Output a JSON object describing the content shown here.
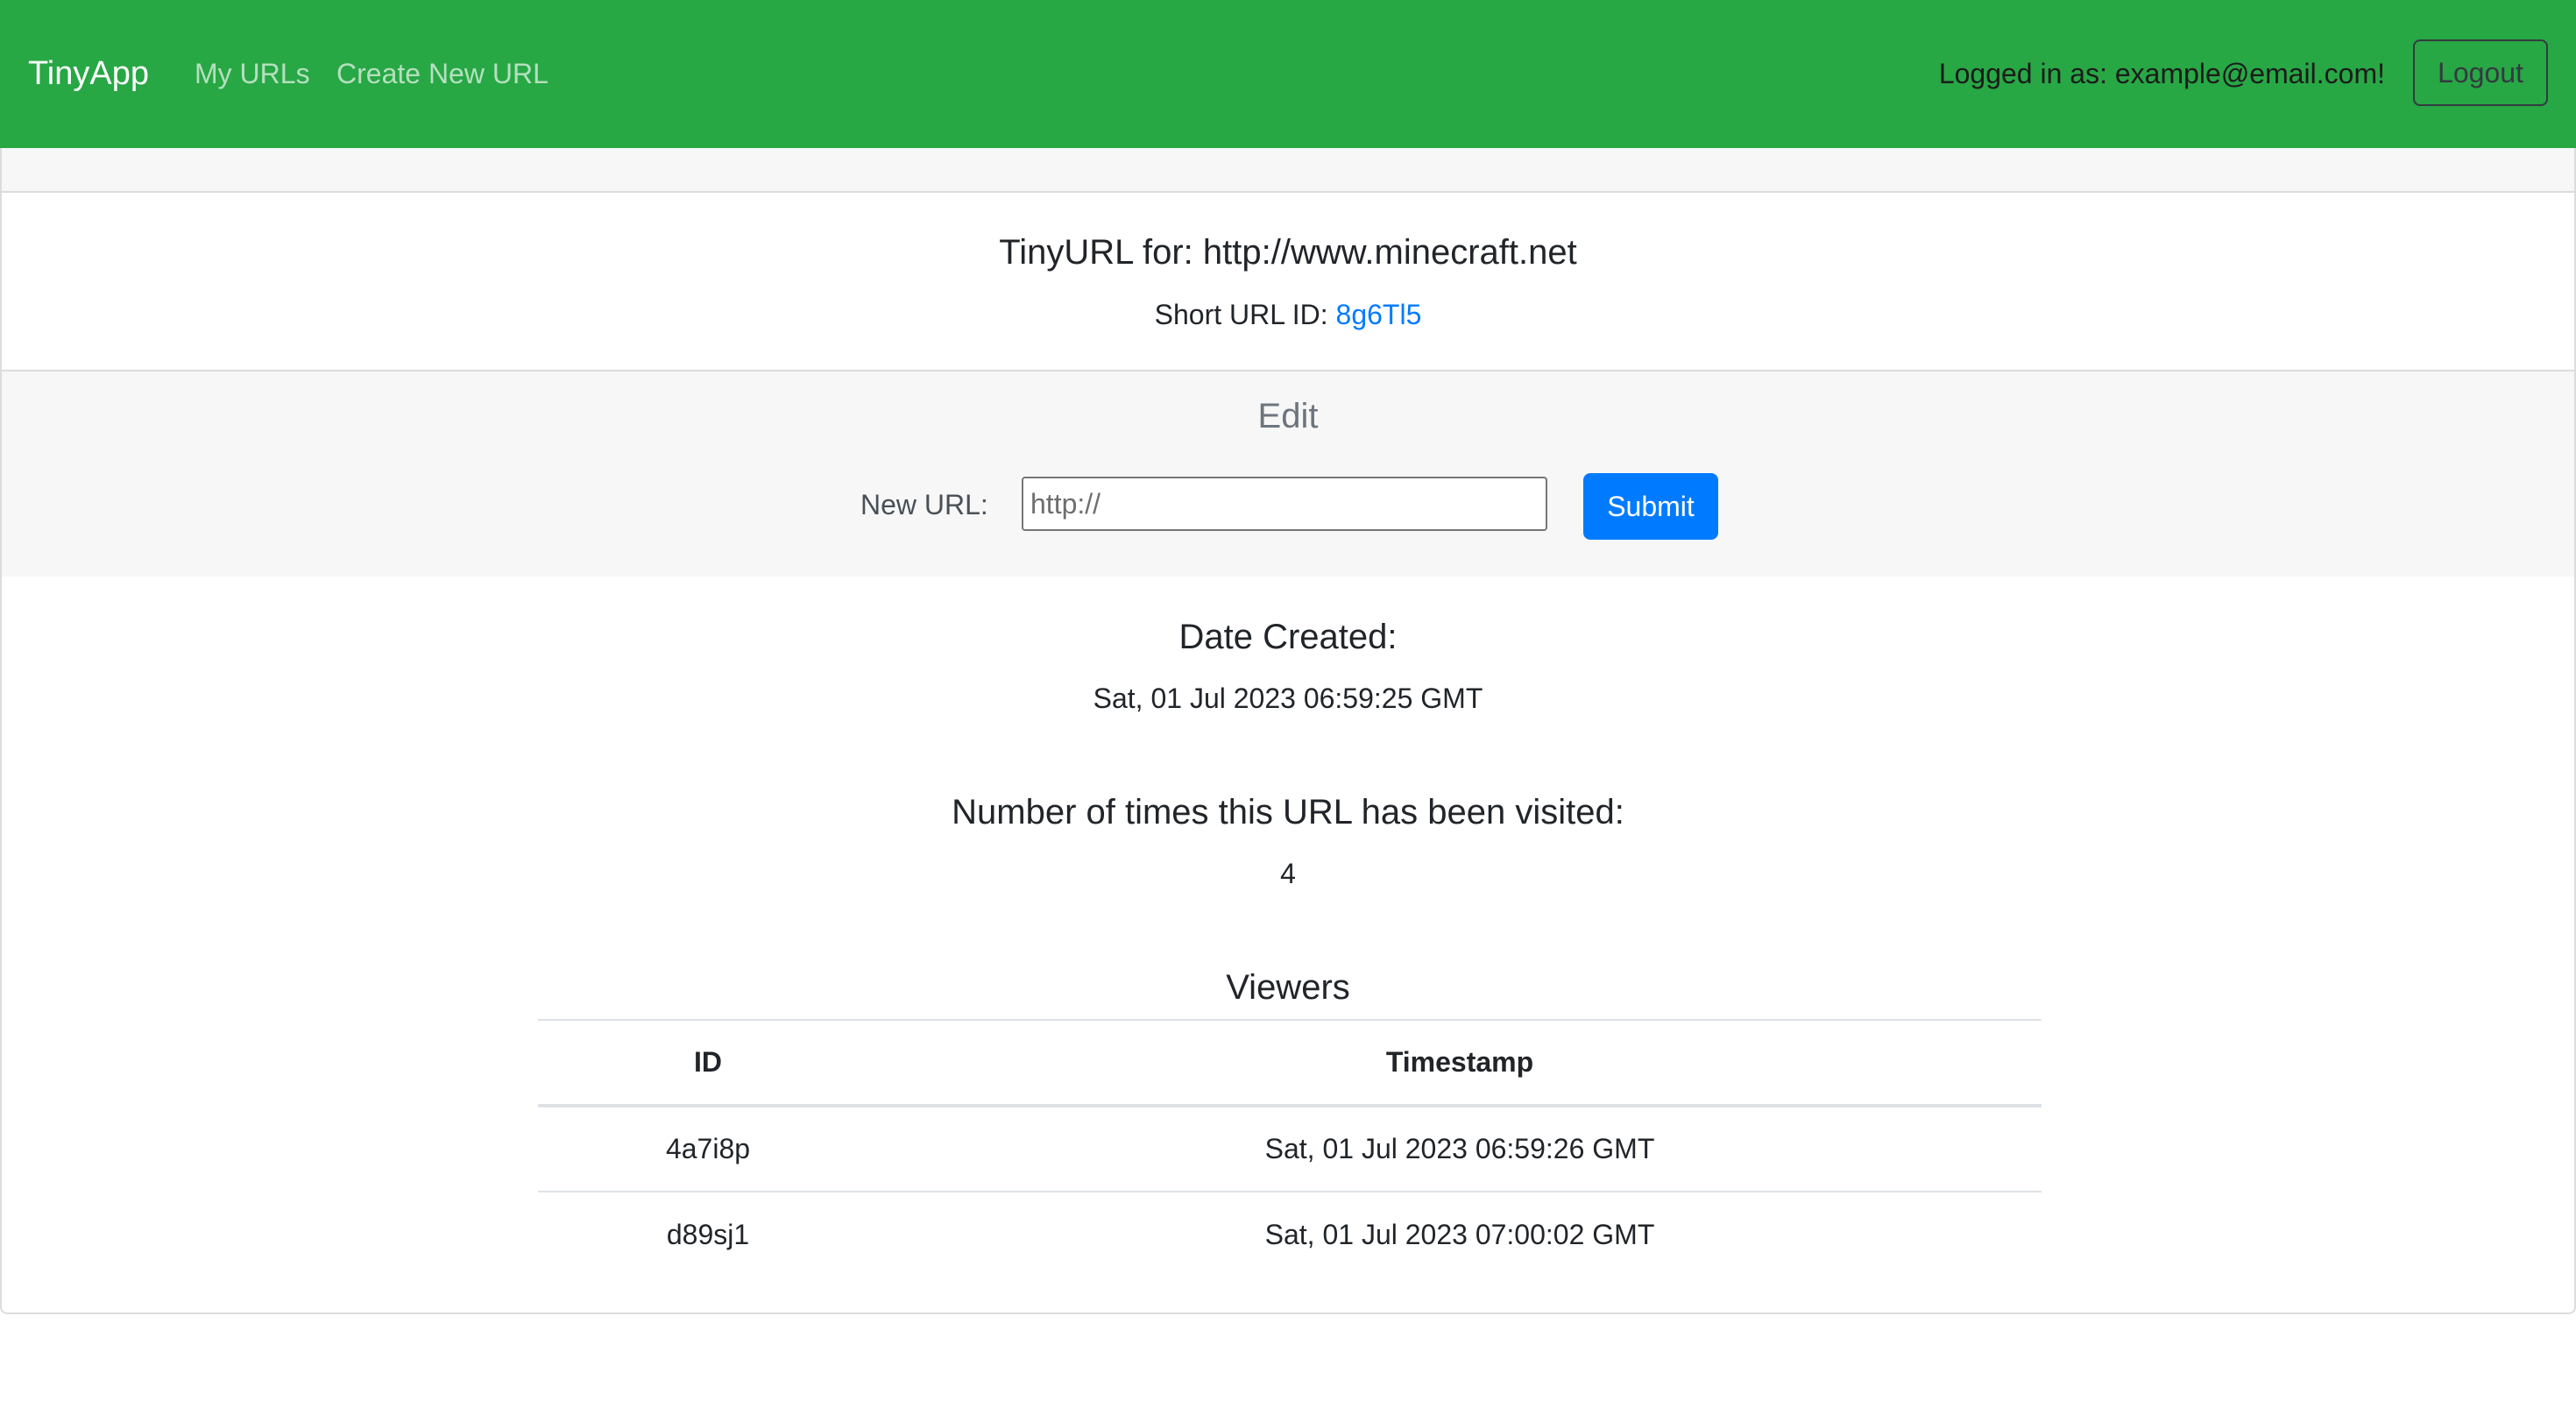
{
  "navbar": {
    "brand": "TinyApp",
    "links": [
      {
        "label": "My URLs"
      },
      {
        "label": "Create New URL"
      }
    ],
    "logged_in_text": "Logged in as: example@email.com!",
    "logout_label": "Logout",
    "background_color": "#28a745"
  },
  "url_info": {
    "title": "TinyURL for: http://www.minecraft.net",
    "short_id_label": "Short URL ID:",
    "short_id": "8g6Tl5"
  },
  "edit": {
    "title": "Edit",
    "new_url_label": "New URL:",
    "input_placeholder": "http://",
    "input_value": "",
    "submit_label": "Submit"
  },
  "date_created": {
    "label": "Date Created:",
    "value": "Sat, 01 Jul 2023 06:59:25 GMT"
  },
  "visits": {
    "label": "Number of times this URL has been visited:",
    "value": "4"
  },
  "viewers": {
    "title": "Viewers",
    "columns": [
      "ID",
      "Timestamp"
    ],
    "rows": [
      {
        "id": "4a7i8p",
        "timestamp": "Sat, 01 Jul 2023 06:59:26 GMT"
      },
      {
        "id": "d89sj1",
        "timestamp": "Sat, 01 Jul 2023 07:00:02 GMT"
      }
    ]
  }
}
